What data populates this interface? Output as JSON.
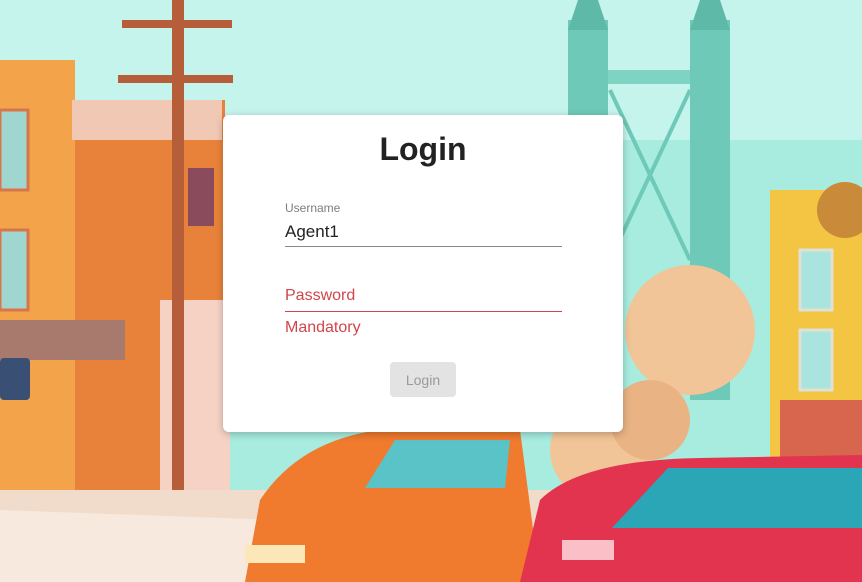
{
  "login": {
    "title": "Login",
    "username_label": "Username",
    "username_value": "Agent1",
    "password_placeholder": "Password",
    "password_error": "Mandatory",
    "button_label": "Login"
  },
  "colors": {
    "error": "#d0454b",
    "sky": "#a8ece0",
    "button_bg": "#e3e3e3"
  }
}
